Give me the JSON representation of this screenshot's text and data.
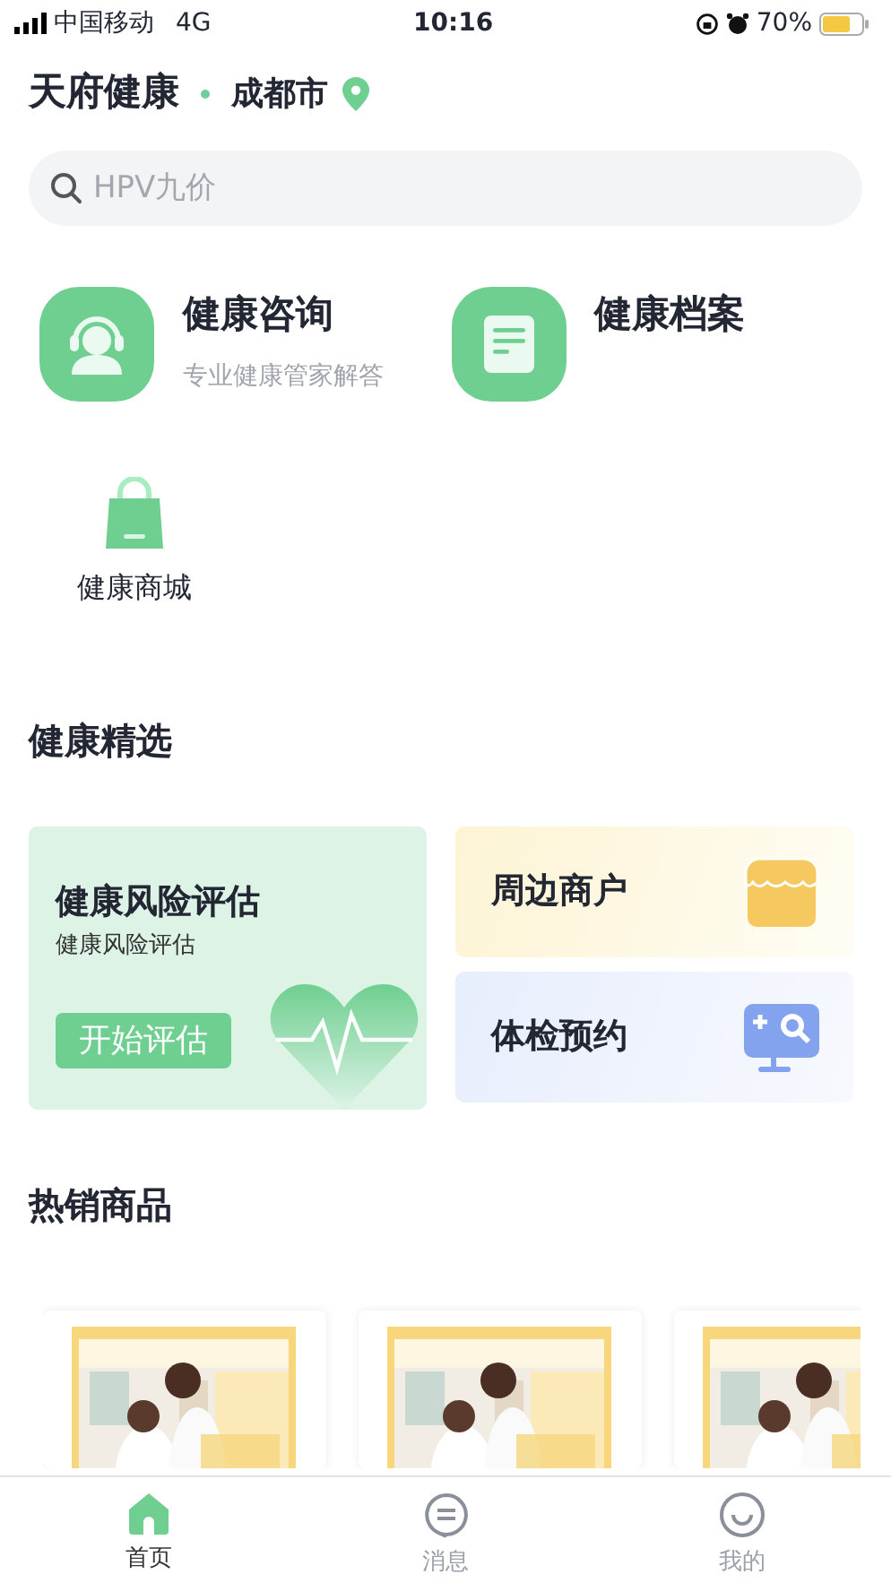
{
  "status_bar": {
    "carrier": "中国移动",
    "network": "4G",
    "time": "10:16",
    "battery": "70%"
  },
  "header": {
    "title": "天府健康",
    "city": "成都市"
  },
  "search": {
    "placeholder": "HPV九价"
  },
  "services": [
    {
      "kind": "consult",
      "title": "健康咨询",
      "subtitle": "专业健康管家解答"
    },
    {
      "kind": "records",
      "title": "健康档案"
    }
  ],
  "shop": {
    "label": "健康商城"
  },
  "featured": {
    "title": "健康精选",
    "main_card": {
      "title": "健康风险评估",
      "subtitle": "健康风险评估",
      "button": "开始评估"
    },
    "side_cards": [
      {
        "kind": "shop",
        "title": "周边商户"
      },
      {
        "kind": "checkup",
        "title": "体检预约"
      }
    ]
  },
  "hot_products": {
    "title": "热销商品"
  },
  "tabs": [
    {
      "kind": "home",
      "label": "首页",
      "selected": true
    },
    {
      "kind": "message",
      "label": "消息",
      "selected": false
    },
    {
      "kind": "profile",
      "label": "我的",
      "selected": false
    }
  ]
}
